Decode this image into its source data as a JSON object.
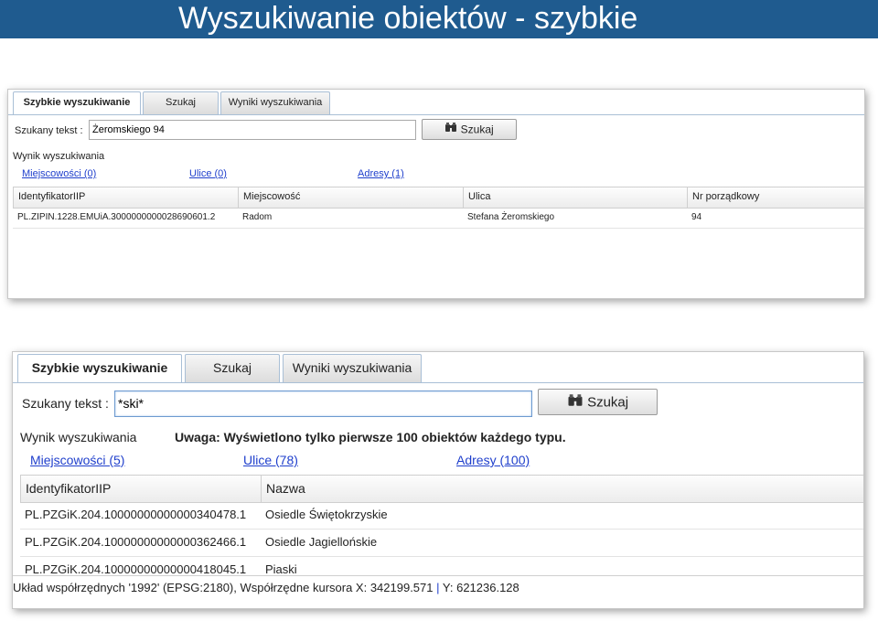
{
  "slide": {
    "title": "Wyszukiwanie obiektów - szybkie"
  },
  "panel1": {
    "tabs": [
      {
        "label": "Szybkie wyszukiwanie",
        "active": true
      },
      {
        "label": "Szukaj",
        "active": false
      },
      {
        "label": "Wyniki wyszukiwania",
        "active": false
      }
    ],
    "search_label": "Szukany tekst :",
    "search_value": "Żeromskiego 94",
    "search_button": "Szukaj",
    "result_label": "Wynik wyszukiwania",
    "result_links": [
      "Miejscowości (0)",
      "Ulice (0)",
      "Adresy (1)"
    ],
    "columns": [
      "IdentyfikatorIIP",
      "Miejscowość",
      "Ulica",
      "Nr porządkowy"
    ],
    "rows": [
      [
        "PL.ZIPIN.1228.EMUiA.3000000000028690601.2",
        "Radom",
        "Stefana Żeromskiego",
        "94"
      ]
    ]
  },
  "panel2": {
    "tabs": [
      {
        "label": "Szybkie wyszukiwanie",
        "active": true
      },
      {
        "label": "Szukaj",
        "active": false
      },
      {
        "label": "Wyniki wyszukiwania",
        "active": false
      }
    ],
    "search_label": "Szukany tekst :",
    "search_value": "*ski*",
    "search_button": "Szukaj",
    "result_label": "Wynik wyszukiwania",
    "warning": "Uwaga: Wyświetlono tylko pierwsze 100 obiektów każdego typu.",
    "result_links": [
      "Miejscowości (5)",
      "Ulice (78)",
      "Adresy (100)"
    ],
    "columns": [
      "IdentyfikatorIIP",
      "Nazwa"
    ],
    "rows": [
      [
        "PL.PZGiK.204.10000000000000340478.1",
        "Osiedle Świętokrzyskie"
      ],
      [
        "PL.PZGiK.204.10000000000000362466.1",
        "Osiedle Jagiellońskie"
      ],
      [
        "PL.PZGiK.204.10000000000000418045.1",
        "Piaski"
      ]
    ],
    "status_main": "Układ współrzędnych '1992' (EPSG:2180), Współrzędne kursora X: 342199.571",
    "status_sep": "|",
    "status_y": "Y: 621236.128"
  },
  "icons": {
    "search_button_icon": "binoculars-icon"
  }
}
